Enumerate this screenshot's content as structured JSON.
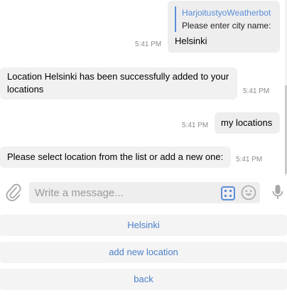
{
  "chat": {
    "messages": [
      {
        "direction": "outgoing",
        "reply_author": "HarjoitustyoWeatherbot",
        "reply_text": "Please enter city name:",
        "text": "Helsinki",
        "time": "5:41 PM"
      },
      {
        "direction": "incoming",
        "text": "Location Helsinki has been successfully added to your locations",
        "time": "5:41 PM"
      },
      {
        "direction": "outgoing",
        "text": "my locations",
        "time": "5:41 PM"
      },
      {
        "direction": "incoming",
        "text": "Please select location from the list or add a new one:",
        "time": "5:41 PM"
      }
    ]
  },
  "composer": {
    "placeholder": "Write a message...",
    "icons": [
      "paperclip-icon",
      "bot-keyboard-icon",
      "emoji-icon",
      "microphone-icon"
    ],
    "accent_color": "#5b8dd9"
  },
  "keyboard": {
    "buttons": [
      "Helsinki",
      "add new location",
      "back"
    ],
    "text_color": "#4a7fc8"
  }
}
